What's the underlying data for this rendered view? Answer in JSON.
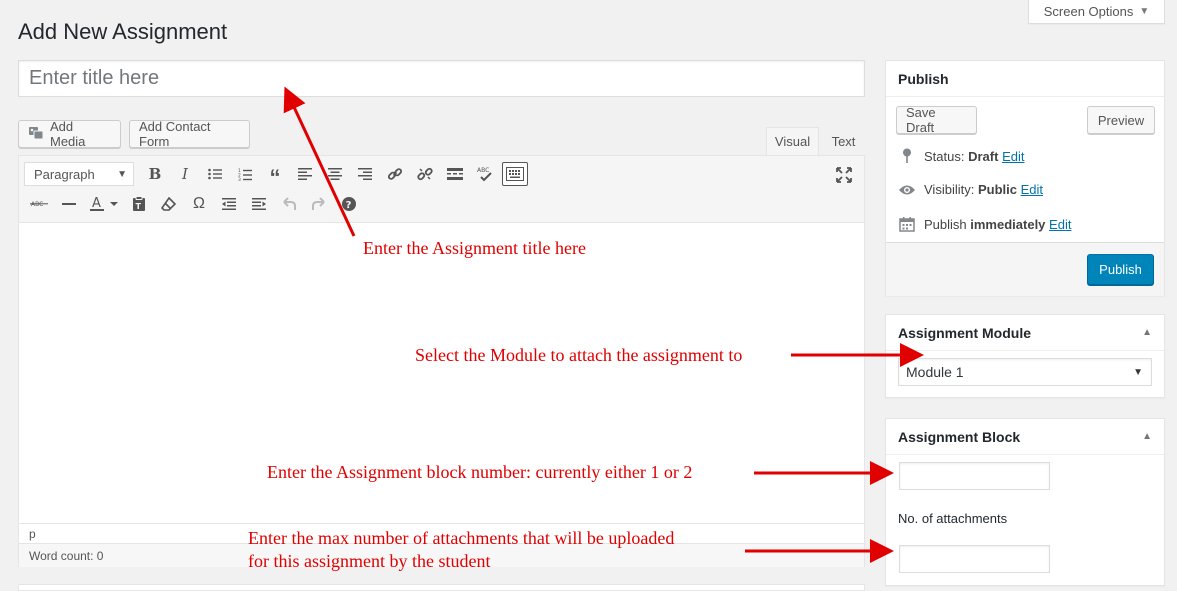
{
  "page": {
    "title": "Add New Assignment",
    "screen_options": "Screen Options"
  },
  "title_field": {
    "placeholder": "Enter title here"
  },
  "media_buttons": {
    "add_media": "Add Media",
    "add_contact_form": "Add Contact Form"
  },
  "editor": {
    "tabs": [
      "Visual",
      "Text"
    ],
    "active_tab": "Visual",
    "format_select": "Paragraph",
    "path": "p",
    "word_count": "Word count: 0",
    "toolbar_icons": [
      "bold-icon",
      "italic-icon",
      "bullet-list-icon",
      "numbered-list-icon",
      "blockquote-icon",
      "align-left-icon",
      "align-center-icon",
      "align-right-icon",
      "link-icon",
      "unlink-icon",
      "read-more-icon",
      "spellcheck-icon",
      "toolbar-toggle-icon",
      "strikethrough-icon",
      "horizontal-line-icon",
      "text-color-icon",
      "paste-text-icon",
      "clear-formatting-icon",
      "special-character-icon",
      "outdent-icon",
      "indent-icon",
      "undo-icon",
      "redo-icon",
      "help-icon",
      "fullscreen-icon"
    ]
  },
  "publish_box": {
    "title": "Publish",
    "save_draft": "Save Draft",
    "preview": "Preview",
    "status_label": "Status:",
    "status_value": "Draft",
    "visibility_label": "Visibility:",
    "visibility_value": "Public",
    "publish_label": "Publish",
    "publish_value": "immediately",
    "edit": "Edit",
    "publish_button": "Publish"
  },
  "module_box": {
    "title": "Assignment Module",
    "selected": "Module 1"
  },
  "block_box": {
    "title": "Assignment Block",
    "attachments_label": "No. of attachments"
  },
  "annotations": {
    "title_hint": "Enter the Assignment title here",
    "module_hint": "Select the Module to attach the assignment to",
    "block_hint": "Enter the Assignment block number: currently either 1 or 2",
    "attachments_hint_1": "Enter the max number of attachments that will be uploaded",
    "attachments_hint_2": "for this assignment by the student"
  },
  "colors": {
    "primary": "#0085ba",
    "link": "#0073aa",
    "annotation": "#e00000",
    "background": "#f1f1f1"
  }
}
